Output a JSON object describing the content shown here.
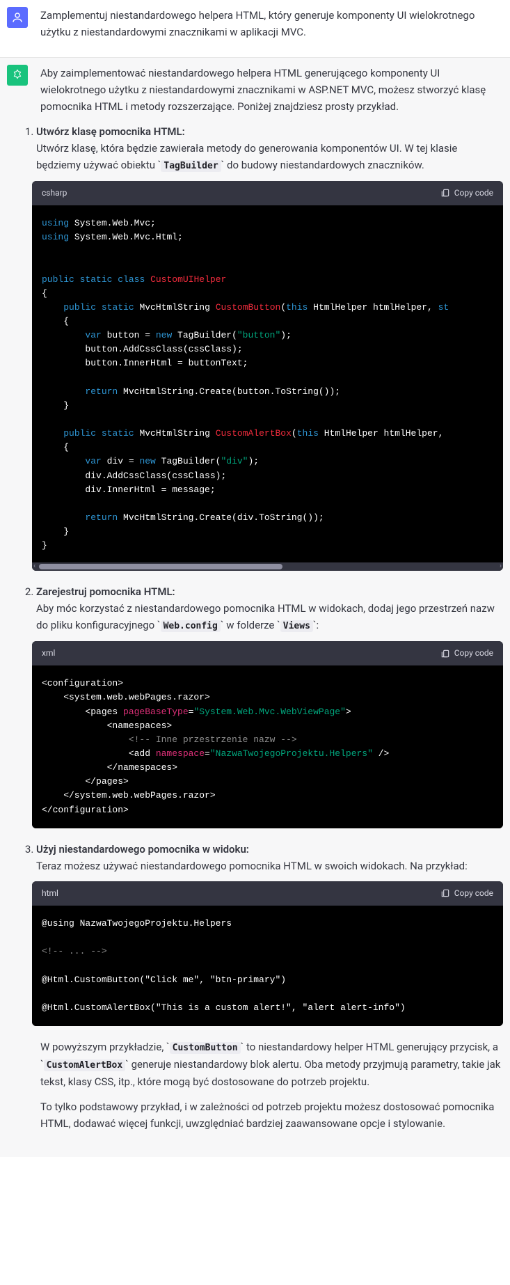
{
  "user_message": "Zamplementuj niestandardowego helpera HTML, który generuje komponenty UI wielokrotnego użytku z niestandardowymi znacznikami w aplikacji MVC.",
  "assistant_intro": "Aby zaimplementować niestandardowego helpera HTML generującego komponenty UI wielokrotnego użytku z niestandardowymi znacznikami w ASP.NET MVC, możesz stworzyć klasę pomocnika HTML i metody rozszerzające. Poniżej znajdziesz prosty przykład.",
  "steps": {
    "s1": {
      "title": "Utwórz klasę pomocnika HTML:",
      "desc_pre": "Utwórz klasę, która będzie zawierała metody do generowania komponentów UI. W tej klasie będziemy używać obiektu ",
      "desc_code": "TagBuilder",
      "desc_post": " do budowy niestandardowych znaczników.",
      "lang": "csharp",
      "copy": "Copy code"
    },
    "s2": {
      "title": "Zarejestruj pomocnika HTML:",
      "desc_pre": "Aby móc korzystać z niestandardowego pomocnika HTML w widokach, dodaj jego przestrzeń nazw do pliku konfiguracyjnego ",
      "desc_code1": "Web.config",
      "desc_mid": " w folderze ",
      "desc_code2": "Views",
      "desc_post": ":",
      "lang": "xml",
      "copy": "Copy code"
    },
    "s3": {
      "title": "Użyj niestandardowego pomocnika w widoku:",
      "desc": "Teraz możesz używać niestandardowego pomocnika HTML w swoich widokach. Na przykład:",
      "lang": "html",
      "copy": "Copy code"
    }
  },
  "summary_p1_pre": "W powyższym przykładzie, ",
  "summary_p1_c1": "CustomButton",
  "summary_p1_mid": " to niestandardowy helper HTML generujący przycisk, a ",
  "summary_p1_c2": "CustomAlertBox",
  "summary_p1_post": " generuje niestandardowy blok alertu. Oba metody przyjmują parametry, takie jak tekst, klasy CSS, itp., które mogą być dostosowane do potrzeb projektu.",
  "summary_p2": "To tylko podstawowy przykład, i w zależności od potrzeb projektu możesz dostosować pomocnika HTML, dodawać więcej funkcji, uwzględniać bardziej zaawansowane opcje i stylowanie."
}
